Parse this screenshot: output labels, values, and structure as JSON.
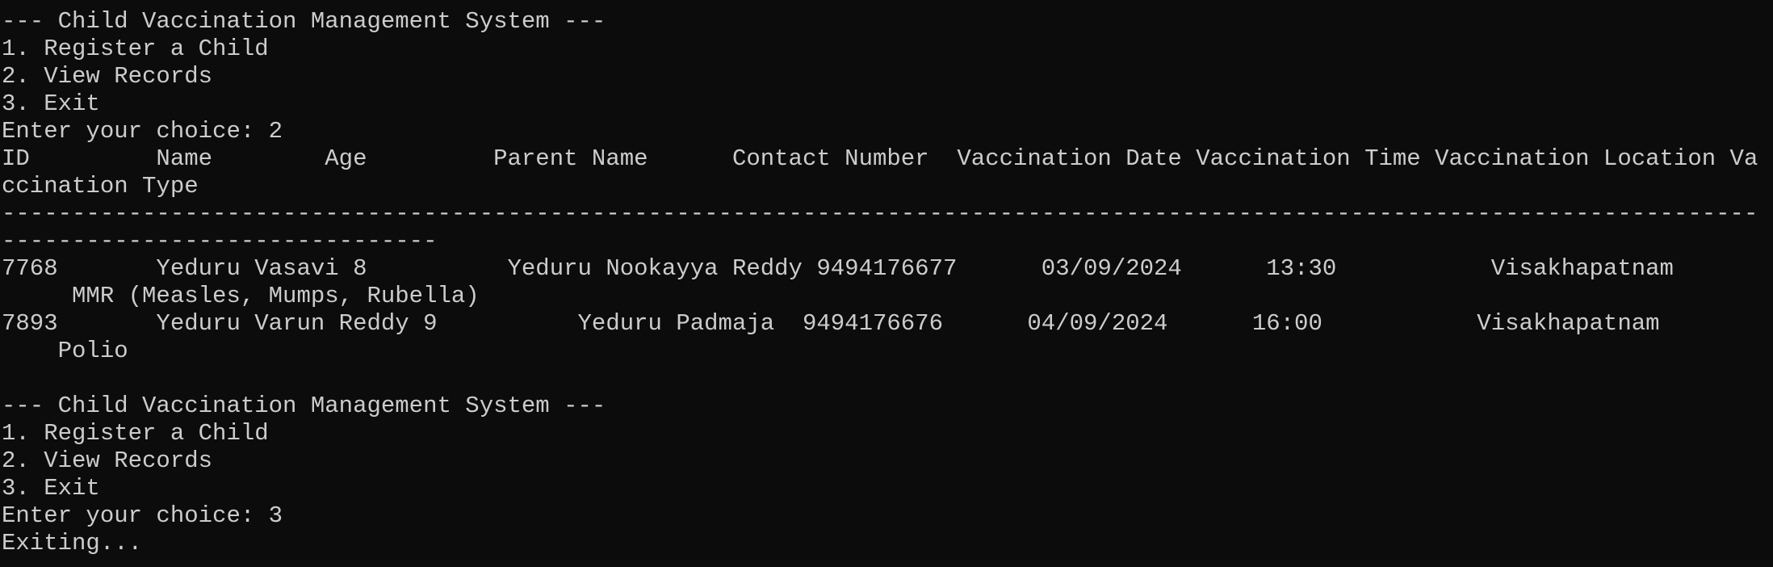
{
  "console": {
    "lines": [
      "--- Child Vaccination Management System ---",
      "1. Register a Child",
      "2. View Records",
      "3. Exit",
      "Enter your choice: 2",
      "ID         Name        Age         Parent Name      Contact Number  Vaccination Date Vaccination Time Vaccination Location Va",
      "ccination Type",
      "-----------------------------------------------------------------------------------------------------------------------------",
      "-------------------------------",
      "7768       Yeduru Vasavi 8          Yeduru Nookayya Reddy 9494176677      03/09/2024      13:30           Visakhapatnam",
      "     MMR (Measles, Mumps, Rubella)",
      "7893       Yeduru Varun Reddy 9          Yeduru Padmaja  9494176676      04/09/2024      16:00           Visakhapatnam",
      "    Polio",
      "",
      "--- Child Vaccination Management System ---",
      "1. Register a Child",
      "2. View Records",
      "3. Exit",
      "Enter your choice: 3",
      "Exiting..."
    ]
  }
}
